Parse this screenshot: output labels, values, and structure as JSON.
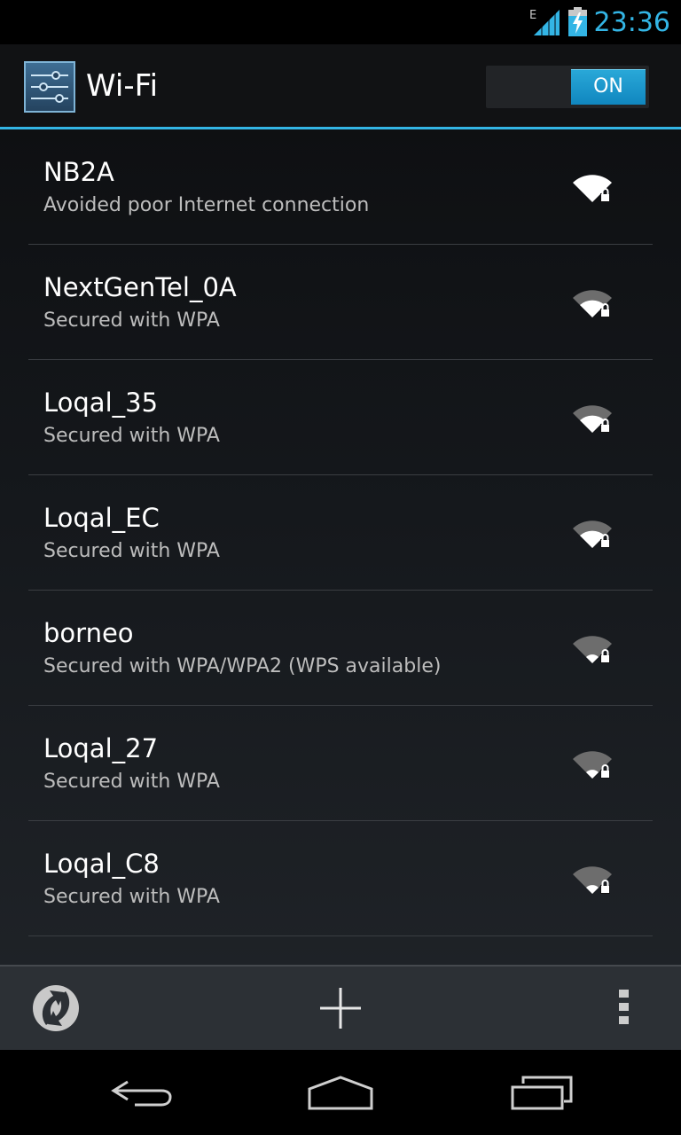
{
  "status_bar": {
    "network_type": "E",
    "time": "23:36",
    "accent_color": "#33b5e5",
    "icons": [
      "signal-icon",
      "battery-charging-icon"
    ]
  },
  "action_bar": {
    "title": "Wi-Fi",
    "app_icon": "settings-sliders-icon",
    "toggle_label": "ON",
    "toggle_state": "on"
  },
  "networks": [
    {
      "ssid": "NB2A",
      "summary": "Avoided poor Internet connection",
      "secured": true,
      "signal_level": 4
    },
    {
      "ssid": "NextGenTel_0A",
      "summary": "Secured with WPA",
      "secured": true,
      "signal_level": 2
    },
    {
      "ssid": "Loqal_35",
      "summary": "Secured with WPA",
      "secured": true,
      "signal_level": 2
    },
    {
      "ssid": "Loqal_EC",
      "summary": "Secured with WPA",
      "secured": true,
      "signal_level": 2
    },
    {
      "ssid": "borneo",
      "summary": "Secured with WPA/WPA2 (WPS available)",
      "secured": true,
      "signal_level": 1
    },
    {
      "ssid": "Loqal_27",
      "summary": "Secured with WPA",
      "secured": true,
      "signal_level": 1
    },
    {
      "ssid": "Loqal_C8",
      "summary": "Secured with WPA",
      "secured": true,
      "signal_level": 1
    }
  ],
  "bottom_bar": {
    "actions": [
      "wps-icon",
      "add-network-icon",
      "overflow-menu-icon"
    ]
  },
  "nav_bar": {
    "buttons": [
      "back-icon",
      "home-icon",
      "recent-apps-icon"
    ]
  }
}
